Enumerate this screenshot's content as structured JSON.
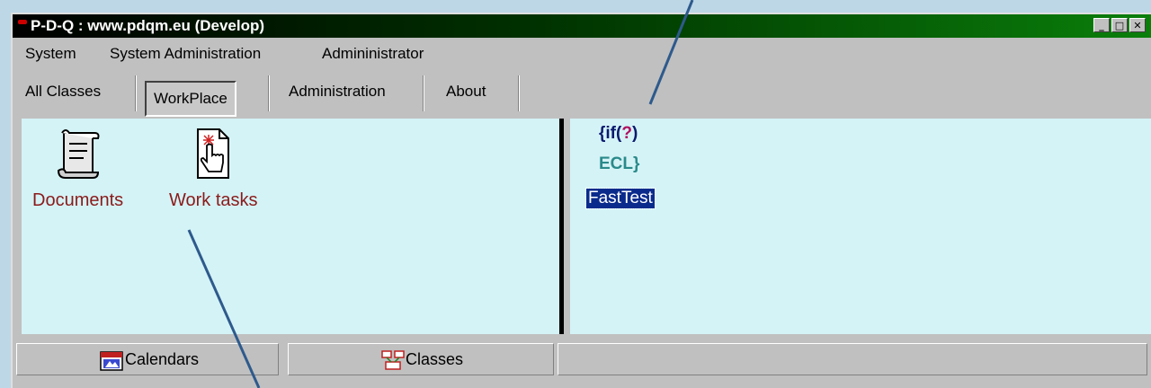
{
  "window": {
    "title": "P-D-Q : www.pdqm.eu (Develop)",
    "buttons": [
      "minimize",
      "maximize",
      "close"
    ]
  },
  "menubar": {
    "items": [
      "System",
      "System Administration",
      "Admininistrator"
    ]
  },
  "tabs": [
    {
      "label": "All Classes",
      "active": false
    },
    {
      "label": "WorkPlace",
      "active": true
    },
    {
      "label": "Administration",
      "active": false
    },
    {
      "label": "About",
      "active": false
    }
  ],
  "left_pane": {
    "items": [
      {
        "label": "Documents",
        "icon": "scroll-document-icon"
      },
      {
        "label": "Work tasks",
        "icon": "page-hand-pointer-icon"
      }
    ]
  },
  "right_pane": {
    "logo_line1_prefix": "{if(",
    "logo_line1_q": "?",
    "logo_line1_suffix": ")",
    "logo_line2": "ECL}",
    "selected_item": "FastTest"
  },
  "statusbar": {
    "calendars": "Calendars",
    "classes": "Classes"
  },
  "colors": {
    "pane_bg": "#d4f3f6",
    "item_text": "#8b1a1a",
    "selection": "#0a2b8c",
    "arrow": "#2e5a8c"
  }
}
